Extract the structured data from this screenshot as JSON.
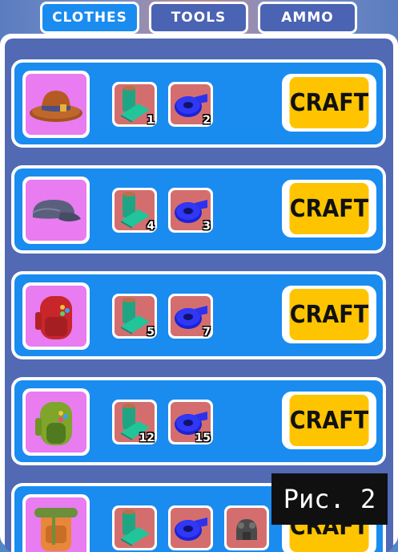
{
  "tabs": [
    {
      "label": "CLOTHES",
      "active": true
    },
    {
      "label": "TOOLS",
      "active": false
    },
    {
      "label": "AMMO",
      "active": false
    }
  ],
  "recipes": [
    {
      "item_icon": "hat-icon",
      "resources": [
        {
          "icon": "fabric-roll-icon",
          "count": "1"
        },
        {
          "icon": "tape-roll-icon",
          "count": "2"
        }
      ],
      "craft_label": "CRAFT"
    },
    {
      "item_icon": "cap-icon",
      "resources": [
        {
          "icon": "fabric-roll-icon",
          "count": "4"
        },
        {
          "icon": "tape-roll-icon",
          "count": "3"
        }
      ],
      "craft_label": "CRAFT"
    },
    {
      "item_icon": "red-backpack-icon",
      "resources": [
        {
          "icon": "fabric-roll-icon",
          "count": "5"
        },
        {
          "icon": "tape-roll-icon",
          "count": "7"
        }
      ],
      "craft_label": "CRAFT"
    },
    {
      "item_icon": "green-backpack-icon",
      "resources": [
        {
          "icon": "fabric-roll-icon",
          "count": "12"
        },
        {
          "icon": "tape-roll-icon",
          "count": "15"
        }
      ],
      "craft_label": "CRAFT"
    },
    {
      "item_icon": "travel-backpack-icon",
      "resources": [
        {
          "icon": "fabric-roll-icon",
          "count": ""
        },
        {
          "icon": "tape-roll-icon",
          "count": ""
        },
        {
          "icon": "metal-part-icon",
          "count": ""
        }
      ],
      "craft_label": "CRAFT"
    }
  ],
  "caption": "Рис. 2",
  "colors": {
    "tab_active": "#1a8cf0",
    "tab_inactive": "#4a63b3",
    "row_bg": "#1a8cf0",
    "item_bg": "#e87cf0",
    "resource_bg": "#d46e6e",
    "craft_button": "#ffc400",
    "panel_bg": "#5269b4"
  }
}
